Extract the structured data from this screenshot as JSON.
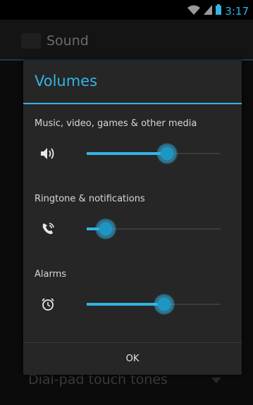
{
  "status_bar": {
    "time": "3:17",
    "icons": [
      "wifi-icon",
      "signal-icon",
      "battery-icon"
    ]
  },
  "app_bar": {
    "title": "Sound",
    "icon": "settings-app-icon"
  },
  "background": {
    "row_label": "Dial-pad touch tones"
  },
  "dialog": {
    "title": "Volumes",
    "volumes": [
      {
        "label": "Music, video, games & other media",
        "icon": "speaker-icon",
        "level": 0.6
      },
      {
        "label": "Ringtone & notifications",
        "icon": "phone-ring-icon",
        "level": 0.14
      },
      {
        "label": "Alarms",
        "icon": "alarm-clock-icon",
        "level": 0.58
      }
    ],
    "ok_label": "OK"
  },
  "colors": {
    "accent": "#33b5e5",
    "dialog_bg": "#262626",
    "screen_bg": "#0b0b0b"
  }
}
